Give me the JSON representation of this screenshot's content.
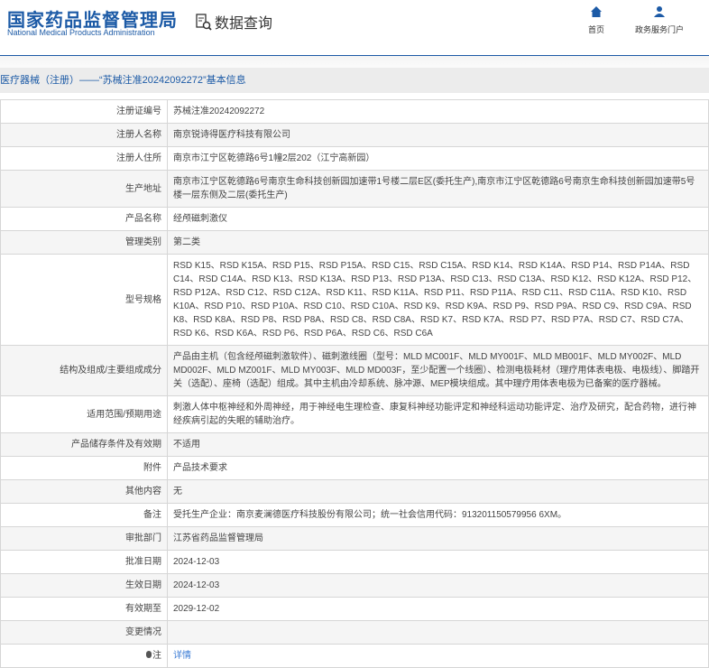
{
  "header": {
    "logo_cn": "国家药品监督管理局",
    "logo_en": "National Medical Products Administration",
    "data_query": "数据查询",
    "nav": [
      {
        "label": "首页",
        "icon": "home-icon"
      },
      {
        "label": "政务服务门户",
        "icon": "user-icon"
      }
    ]
  },
  "breadcrumb": "医疗器械（注册）——“苏械注准20242092272”基本信息",
  "rows": [
    {
      "label": "注册证编号",
      "value": "苏械注准20242092272"
    },
    {
      "label": "注册人名称",
      "value": "南京锐诗得医疗科技有限公司"
    },
    {
      "label": "注册人住所",
      "value": "南京市江宁区乾德路6号1幢2层202（江宁高新园）"
    },
    {
      "label": "生产地址",
      "value": "南京市江宁区乾德路6号南京生命科技创新园加速带1号楼二层E区(委托生产),南京市江宁区乾德路6号南京生命科技创新园加速带5号楼一层东侧及二层(委托生产)"
    },
    {
      "label": "产品名称",
      "value": "经颅磁刺激仪"
    },
    {
      "label": "管理类别",
      "value": "第二类"
    },
    {
      "label": "型号规格",
      "value": "RSD K15、RSD K15A、RSD P15、RSD P15A、RSD C15、RSD C15A、RSD K14、RSD K14A、RSD P14、RSD P14A、RSD C14、RSD C14A、RSD K13、RSD K13A、RSD P13、RSD P13A、RSD C13、RSD C13A、RSD K12、RSD K12A、RSD P12、RSD P12A、RSD C12、RSD C12A、RSD K11、RSD K11A、RSD P11、RSD P11A、RSD C11、RSD C11A、RSD K10、RSD K10A、RSD P10、RSD P10A、RSD C10、RSD C10A、RSD K9、RSD K9A、RSD P9、RSD P9A、RSD C9、RSD C9A、RSD K8、RSD K8A、RSD P8、RSD P8A、RSD C8、RSD C8A、RSD K7、RSD K7A、RSD P7、RSD P7A、RSD C7、RSD C7A、RSD K6、RSD K6A、RSD P6、RSD P6A、RSD C6、RSD C6A"
    },
    {
      "label": "结构及组成/主要组成成分",
      "value": "产品由主机（包含经颅磁刺激软件）、磁刺激线圈（型号：MLD MC001F、MLD MY001F、MLD MB001F、MLD MY002F、MLD MD002F、MLD MZ001F、MLD MY003F、MLD MD003F，至少配置一个线圈）、检测电极耗材（理疗用体表电极、电极线）、脚踏开关（选配）、座椅（选配）组成。其中主机由冷却系统、脉冲源、MEP模块组成。其中理疗用体表电极为已备案的医疗器械。"
    },
    {
      "label": "适用范围/预期用途",
      "value": "刺激人体中枢神经和外周神经，用于神经电生理检查、康复科神经功能评定和神经科运动功能评定、治疗及研究，配合药物，进行神经疾病引起的失眠的辅助治疗。"
    },
    {
      "label": "产品储存条件及有效期",
      "value": "不适用"
    },
    {
      "label": "附件",
      "value": "产品技术要求"
    },
    {
      "label": "其他内容",
      "value": "无"
    },
    {
      "label": "备注",
      "value": "受托生产企业：南京麦澜德医疗科技股份有限公司；统一社会信用代码：913201150579956 6XM。"
    },
    {
      "label": "审批部门",
      "value": "江苏省药品监督管理局"
    },
    {
      "label": "批准日期",
      "value": "2024-12-03"
    },
    {
      "label": "生效日期",
      "value": "2024-12-03"
    },
    {
      "label": "有效期至",
      "value": "2029-12-02"
    },
    {
      "label": "变更情况",
      "value": ""
    }
  ],
  "note": {
    "label": "注",
    "link": "详情"
  }
}
